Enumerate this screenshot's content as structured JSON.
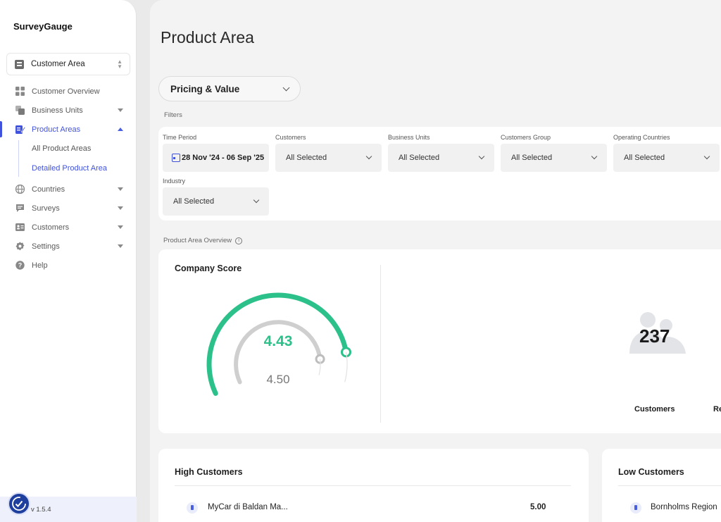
{
  "app": {
    "brand": "SurveyGauge",
    "version": "v 1.5.4"
  },
  "org_switcher": {
    "label": "Customer Area"
  },
  "sidebar": {
    "items": [
      {
        "label": "Customer Overview",
        "icon": "grid-icon"
      },
      {
        "label": "Business Units",
        "icon": "layers-icon"
      },
      {
        "label": "Product Areas",
        "icon": "edit-icon",
        "active": true
      },
      {
        "label": "Countries",
        "icon": "globe-icon"
      },
      {
        "label": "Surveys",
        "icon": "chat-icon"
      },
      {
        "label": "Customers",
        "icon": "contact-icon"
      },
      {
        "label": "Settings",
        "icon": "gear-icon"
      },
      {
        "label": "Help",
        "icon": "help-icon"
      }
    ],
    "sub_items": [
      {
        "label": "All Product Areas"
      },
      {
        "label": "Detailed Product Area",
        "active": true
      }
    ]
  },
  "page": {
    "title": "Product Area"
  },
  "topic_select": {
    "value": "Pricing & Value"
  },
  "filters": {
    "section_label": "Filters",
    "time_period": {
      "label": "Time Period",
      "value": "28 Nov '24 - 06 Sep '25"
    },
    "customers": {
      "label": "Customers",
      "value": "All Selected"
    },
    "business_units": {
      "label": "Business Units",
      "value": "All Selected"
    },
    "customers_group": {
      "label": "Customers Group",
      "value": "All Selected"
    },
    "operating_countries": {
      "label": "Operating Countries",
      "value": "All Selected"
    },
    "industry": {
      "label": "Industry",
      "value": "All Selected"
    }
  },
  "overview": {
    "section_label": "Product Area Overview",
    "company_score": {
      "title": "Company Score",
      "value": "4.43",
      "benchmark": "4.50",
      "value_fraction": 0.886,
      "benchmark_fraction": 0.9
    },
    "customers_stat": {
      "value": "237",
      "label": "Customers"
    },
    "second_stat_label": "Re"
  },
  "high_customers": {
    "title": "High Customers",
    "rows": [
      {
        "name": "MyCar di Baldan Ma...",
        "score": "5.00"
      }
    ]
  },
  "low_customers": {
    "title": "Low Customers",
    "rows": [
      {
        "name": "Bornholms Region"
      }
    ]
  },
  "colors": {
    "accent": "#4152dc",
    "gauge_green": "#2cc18b",
    "gauge_gray": "#cfcfcf"
  }
}
